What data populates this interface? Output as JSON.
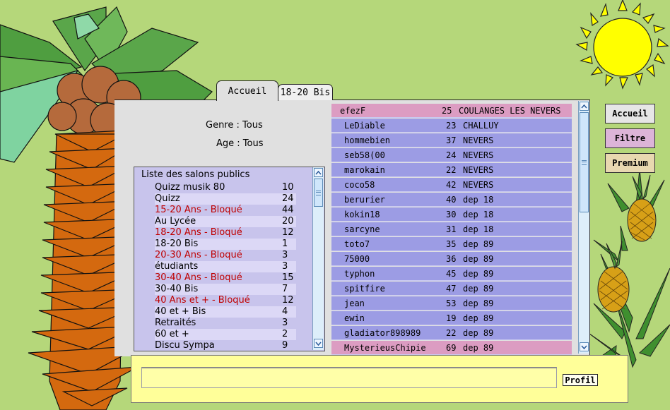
{
  "tabs": [
    {
      "label": "Accueil",
      "active": true
    },
    {
      "label": "18-20 Bis",
      "active": false
    }
  ],
  "filters": {
    "genre": "Genre : Tous",
    "age": "Age : Tous"
  },
  "salons": {
    "title": "Liste des salons publics",
    "blocked_color": "#c00000",
    "rooms": [
      {
        "name": "Quizz musik 80",
        "count": "10",
        "blocked": false
      },
      {
        "name": "Quizz",
        "count": "24",
        "blocked": false
      },
      {
        "name": "15-20 Ans - Bloqué",
        "count": "44",
        "blocked": true
      },
      {
        "name": "Au Lycée",
        "count": "20",
        "blocked": false
      },
      {
        "name": "18-20 Ans - Bloqué",
        "count": "12",
        "blocked": true
      },
      {
        "name": "18-20 Bis",
        "count": "1",
        "blocked": false
      },
      {
        "name": "20-30 Ans - Bloqué",
        "count": "3",
        "blocked": true
      },
      {
        "name": "étudiants",
        "count": "3",
        "blocked": false
      },
      {
        "name": "30-40 Ans - Bloqué",
        "count": "15",
        "blocked": true
      },
      {
        "name": "30-40 Bis",
        "count": "7",
        "blocked": false
      },
      {
        "name": "40 Ans et + - Bloqué",
        "count": "12",
        "blocked": true
      },
      {
        "name": "40 et + Bis",
        "count": "4",
        "blocked": false
      },
      {
        "name": "Retraités",
        "count": "3",
        "blocked": false
      },
      {
        "name": "60 et +",
        "count": "2",
        "blocked": false
      },
      {
        "name": "Discu Sympa",
        "count": "9",
        "blocked": false
      }
    ]
  },
  "users": [
    {
      "nick": "efezF",
      "age": "25",
      "city": "COULANGES LES NEVERS",
      "color": "pink"
    },
    {
      "nick": "LeDiable",
      "age": "23",
      "city": "CHALLUY",
      "color": "blue"
    },
    {
      "nick": "hommebien",
      "age": "37",
      "city": "NEVERS",
      "color": "blue"
    },
    {
      "nick": "seb58(00",
      "age": "24",
      "city": "NEVERS",
      "color": "blue"
    },
    {
      "nick": "marokain",
      "age": "22",
      "city": "NEVERS",
      "color": "blue"
    },
    {
      "nick": "coco58",
      "age": "42",
      "city": "NEVERS",
      "color": "blue"
    },
    {
      "nick": "berurier",
      "age": "40",
      "city": "dep 18",
      "color": "blue"
    },
    {
      "nick": "kokin18",
      "age": "30",
      "city": "dep 18",
      "color": "blue"
    },
    {
      "nick": "sarcyne",
      "age": "31",
      "city": "dep 18",
      "color": "blue"
    },
    {
      "nick": "toto7",
      "age": "35",
      "city": "dep 89",
      "color": "blue"
    },
    {
      "nick": "75000",
      "age": "36",
      "city": "dep 89",
      "color": "blue"
    },
    {
      "nick": "typhon",
      "age": "45",
      "city": "dep 89",
      "color": "blue"
    },
    {
      "nick": "spitfire",
      "age": "47",
      "city": "dep 89",
      "color": "blue"
    },
    {
      "nick": "jean",
      "age": "53",
      "city": "dep 89",
      "color": "blue"
    },
    {
      "nick": "ewin",
      "age": "19",
      "city": "dep 89",
      "color": "blue"
    },
    {
      "nick": "gladiator898989",
      "age": "22",
      "city": "dep 89",
      "color": "blue"
    },
    {
      "nick": "MysterieusChipie",
      "age": "69",
      "city": "dep 89",
      "color": "pink"
    }
  ],
  "side_buttons": [
    {
      "label": "Accueil",
      "name": "accueil-button",
      "bg": "#e6e6e6"
    },
    {
      "label": "Filtre",
      "name": "filtre-button",
      "bg": "#dcb4d8"
    },
    {
      "label": "Premium",
      "name": "premium-button",
      "bg": "#e8d8b0"
    }
  ],
  "message_input": {
    "value": ""
  },
  "profil_button": "Profil",
  "colors": {
    "background": "#b5d77a",
    "panel": "#e0e0e0",
    "user_row_blue": "#9c9ce4",
    "user_row_pink": "#dc9cc2",
    "salon_list_bg": "#c8c4ec",
    "input_area": "#ffff99"
  },
  "decor_icons": [
    "palm-tree-icon",
    "sun-icon",
    "pineapple-icon"
  ]
}
